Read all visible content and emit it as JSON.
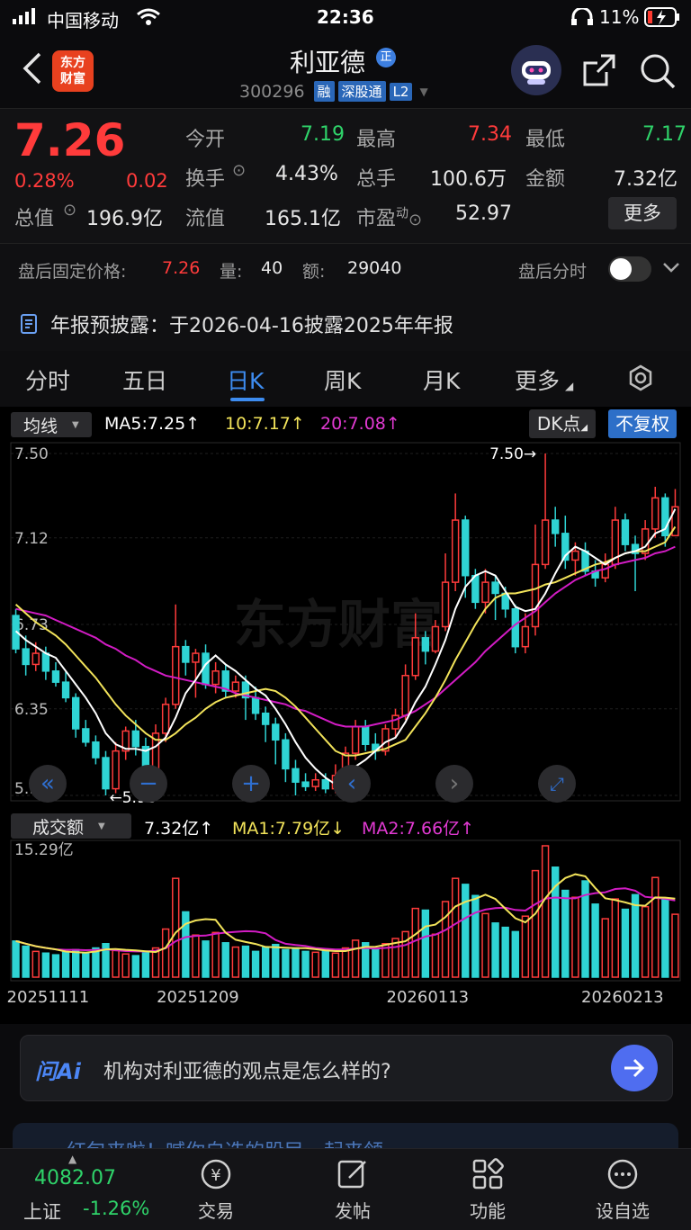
{
  "status_bar": {
    "carrier": "中国移动",
    "time": "22:36",
    "battery": "11%"
  },
  "header": {
    "logo_line1": "东方",
    "logo_line2": "财富",
    "stock_name": "利亚德",
    "badge": "正",
    "code": "300296",
    "tags": [
      "融",
      "深股通",
      "L2"
    ]
  },
  "quote": {
    "price": "7.26",
    "change_pct": "0.28%",
    "change": "0.02",
    "open_label": "今开",
    "open": "7.19",
    "high_label": "最高",
    "high": "7.34",
    "low_label": "最低",
    "low": "7.17",
    "turnover_label": "换手",
    "turnover": "4.43%",
    "volume_label": "总手",
    "volume": "100.6万",
    "amount_label": "金额",
    "amount": "7.32亿",
    "mcap_label": "总值",
    "mcap": "196.9亿",
    "float_label": "流值",
    "float": "165.1亿",
    "pe_label": "市盈",
    "pe_sup": "动",
    "pe": "52.97",
    "more_label": "更多"
  },
  "after_hours": {
    "price_label": "盘后固定价格:",
    "price": "7.26",
    "vol_label": "量:",
    "vol": "40",
    "amt_label": "额:",
    "amt": "29040",
    "switch_label": "盘后分时"
  },
  "notice": {
    "text": "年报预披露：于2026-04-16披露2025年年报"
  },
  "tabs": [
    {
      "label": "分时"
    },
    {
      "label": "五日"
    },
    {
      "label": "日K"
    },
    {
      "label": "周K"
    },
    {
      "label": "月K"
    },
    {
      "label": "更多"
    }
  ],
  "ma_bar": {
    "selector": "均线",
    "ma5": "MA5:7.25",
    "ma10": "10:7.17",
    "ma20": "20:7.08",
    "dk": "DK点",
    "adjust": "不复权"
  },
  "vol_bar": {
    "selector": "成交额",
    "value": "7.32亿",
    "ma1": "MA1:7.79亿",
    "ma2": "MA2:7.66亿",
    "max": "15.29亿"
  },
  "colors": {
    "up": "#ff3b3b",
    "down": "#2fd4d4",
    "ma5": "#ffffff",
    "ma10": "#f2e35a",
    "ma20": "#d21cc4",
    "accent": "#3d8cf0"
  },
  "chart_data": {
    "type": "candlestick",
    "y_ticks": [
      "7.50",
      "7.12",
      "6.73",
      "6.35",
      "5.96"
    ],
    "ylim": [
      5.96,
      7.5
    ],
    "high_marker": "7.50",
    "low_marker": "5.96",
    "dates": [
      "20251111",
      "20251209",
      "20260113",
      "20260213"
    ],
    "candles": [
      [
        6.77,
        6.62,
        6.8,
        6.6
      ],
      [
        6.62,
        6.55,
        6.68,
        6.5
      ],
      [
        6.55,
        6.6,
        6.65,
        6.52
      ],
      [
        6.6,
        6.52,
        6.63,
        6.48
      ],
      [
        6.52,
        6.47,
        6.56,
        6.45
      ],
      [
        6.47,
        6.4,
        6.52,
        6.38
      ],
      [
        6.4,
        6.26,
        6.42,
        6.22
      ],
      [
        6.26,
        6.2,
        6.3,
        6.18
      ],
      [
        6.2,
        6.13,
        6.23,
        6.1
      ],
      [
        6.13,
        5.99,
        6.16,
        5.96
      ],
      [
        5.99,
        6.16,
        6.2,
        5.97
      ],
      [
        6.16,
        6.25,
        6.27,
        6.12
      ],
      [
        6.25,
        6.18,
        6.3,
        6.14
      ],
      [
        6.18,
        6.08,
        6.22,
        6.05
      ],
      [
        6.08,
        6.24,
        6.28,
        6.06
      ],
      [
        6.24,
        6.37,
        6.4,
        6.2
      ],
      [
        6.37,
        6.63,
        6.82,
        6.35
      ],
      [
        6.63,
        6.56,
        6.66,
        6.5
      ],
      [
        6.56,
        6.6,
        6.62,
        6.4
      ],
      [
        6.6,
        6.46,
        6.64,
        6.44
      ],
      [
        6.46,
        6.52,
        6.56,
        6.42
      ],
      [
        6.52,
        6.43,
        6.55,
        6.4
      ],
      [
        6.43,
        6.47,
        6.5,
        6.4
      ],
      [
        6.47,
        6.4,
        6.5,
        6.3
      ],
      [
        6.4,
        6.33,
        6.45,
        6.3
      ],
      [
        6.33,
        6.28,
        6.36,
        6.2
      ],
      [
        6.28,
        6.21,
        6.31,
        6.1
      ],
      [
        6.21,
        6.08,
        6.24,
        6.02
      ],
      [
        6.08,
        6.02,
        6.12,
        5.96
      ],
      [
        6.02,
        6.0,
        6.06,
        5.98
      ],
      [
        6.0,
        6.03,
        6.06,
        5.98
      ],
      [
        6.03,
        5.99,
        6.06,
        5.97
      ],
      [
        5.99,
        6.05,
        6.1,
        5.97
      ],
      [
        6.05,
        6.15,
        6.18,
        6.02
      ],
      [
        6.15,
        6.27,
        6.3,
        6.12
      ],
      [
        6.27,
        6.19,
        6.3,
        6.16
      ],
      [
        6.19,
        6.16,
        6.24,
        6.12
      ],
      [
        6.16,
        6.26,
        6.28,
        6.14
      ],
      [
        6.26,
        6.32,
        6.35,
        6.22
      ],
      [
        6.32,
        6.5,
        6.55,
        6.3
      ],
      [
        6.5,
        6.67,
        6.78,
        6.48
      ],
      [
        6.67,
        6.61,
        6.7,
        6.55
      ],
      [
        6.61,
        6.72,
        6.75,
        6.6
      ],
      [
        6.72,
        6.92,
        7.05,
        6.7
      ],
      [
        6.92,
        7.2,
        7.32,
        6.88
      ],
      [
        7.2,
        6.95,
        7.22,
        6.85
      ],
      [
        6.95,
        6.83,
        6.98,
        6.8
      ],
      [
        6.83,
        6.92,
        6.98,
        6.78
      ],
      [
        6.92,
        6.87,
        6.95,
        6.75
      ],
      [
        6.87,
        6.8,
        6.9,
        6.76
      ],
      [
        6.8,
        6.63,
        6.82,
        6.6
      ],
      [
        6.63,
        6.72,
        6.78,
        6.6
      ],
      [
        6.72,
        7.0,
        7.18,
        6.68
      ],
      [
        7.0,
        7.2,
        7.5,
        6.98
      ],
      [
        7.2,
        7.14,
        7.26,
        7.08
      ],
      [
        7.14,
        7.02,
        7.22,
        6.98
      ],
      [
        7.02,
        7.06,
        7.1,
        6.95
      ],
      [
        7.06,
        6.97,
        7.1,
        6.95
      ],
      [
        6.97,
        6.94,
        7.02,
        6.9
      ],
      [
        6.94,
        7.0,
        7.05,
        6.92
      ],
      [
        7.0,
        7.2,
        7.26,
        6.98
      ],
      [
        7.2,
        7.09,
        7.23,
        7.06
      ],
      [
        7.09,
        7.05,
        7.13,
        6.88
      ],
      [
        7.05,
        7.16,
        7.2,
        7.02
      ],
      [
        7.16,
        7.3,
        7.35,
        7.12
      ],
      [
        7.3,
        7.13,
        7.32,
        7.08
      ],
      [
        7.13,
        7.26,
        7.34,
        7.17
      ]
    ],
    "amounts": [
      4.2,
      3.6,
      3.0,
      2.8,
      2.6,
      2.9,
      3.2,
      2.8,
      3.4,
      3.9,
      3.1,
      2.7,
      2.5,
      2.9,
      3.4,
      5.6,
      11.5,
      7.6,
      4.9,
      4.2,
      5.2,
      4.0,
      3.5,
      3.6,
      3.0,
      3.5,
      3.8,
      3.2,
      3.4,
      3.0,
      2.9,
      3.1,
      2.8,
      3.4,
      4.3,
      4.0,
      3.2,
      3.9,
      4.5,
      5.3,
      8.0,
      7.8,
      5.0,
      8.8,
      11.5,
      10.8,
      9.5,
      7.4,
      6.3,
      5.8,
      5.3,
      7.1,
      12.4,
      15.29,
      12.8,
      10.1,
      9.3,
      11.2,
      8.5,
      6.8,
      9.1,
      7.9,
      9.6,
      8.2,
      11.6,
      9.0,
      7.32
    ],
    "ma5": [
      6.7,
      6.66,
      6.63,
      6.6,
      6.58,
      6.52,
      6.46,
      6.4,
      6.33,
      6.24,
      6.19,
      6.17,
      6.17,
      6.16,
      6.18,
      6.22,
      6.31,
      6.42,
      6.48,
      6.55,
      6.59,
      6.55,
      6.52,
      6.48,
      6.44,
      6.41,
      6.35,
      6.28,
      6.2,
      6.13,
      6.08,
      6.04,
      6.01,
      6.03,
      6.09,
      6.12,
      6.16,
      6.2,
      6.22,
      6.29,
      6.38,
      6.45,
      6.55,
      6.66,
      6.8,
      6.9,
      6.95,
      6.97,
      6.95,
      6.88,
      6.81,
      6.79,
      6.8,
      6.87,
      6.96,
      7.04,
      7.08,
      7.06,
      7.03,
      7.0,
      7.03,
      7.05,
      7.06,
      7.08,
      7.14,
      7.16,
      7.25
    ],
    "ma10": [
      6.82,
      6.78,
      6.74,
      6.71,
      6.68,
      6.64,
      6.59,
      6.54,
      6.49,
      6.43,
      6.37,
      6.32,
      6.28,
      6.24,
      6.21,
      6.21,
      6.24,
      6.28,
      6.31,
      6.35,
      6.38,
      6.4,
      6.41,
      6.42,
      6.43,
      6.44,
      6.43,
      6.4,
      6.36,
      6.31,
      6.26,
      6.21,
      6.16,
      6.14,
      6.14,
      6.15,
      6.16,
      6.17,
      6.19,
      6.21,
      6.27,
      6.33,
      6.4,
      6.48,
      6.57,
      6.65,
      6.73,
      6.8,
      6.85,
      6.87,
      6.87,
      6.88,
      6.89,
      6.91,
      6.92,
      6.94,
      6.96,
      6.98,
      7.0,
      7.01,
      7.03,
      7.05,
      7.06,
      7.06,
      7.08,
      7.1,
      7.17
    ],
    "ma20": [
      6.8,
      6.79,
      6.78,
      6.77,
      6.75,
      6.73,
      6.71,
      6.69,
      6.67,
      6.64,
      6.62,
      6.59,
      6.57,
      6.54,
      6.52,
      6.5,
      6.49,
      6.48,
      6.47,
      6.46,
      6.45,
      6.44,
      6.42,
      6.41,
      6.4,
      6.39,
      6.38,
      6.37,
      6.35,
      6.34,
      6.32,
      6.3,
      6.28,
      6.27,
      6.27,
      6.27,
      6.28,
      6.29,
      6.3,
      6.32,
      6.34,
      6.37,
      6.4,
      6.44,
      6.48,
      6.52,
      6.56,
      6.61,
      6.65,
      6.69,
      6.73,
      6.76,
      6.79,
      6.83,
      6.87,
      6.9,
      6.93,
      6.95,
      6.97,
      6.98,
      7.0,
      7.01,
      7.02,
      7.03,
      7.05,
      7.06,
      7.08
    ]
  },
  "ai": {
    "brand": "问Ai",
    "prompt": "机构对利亚德的观点是怎么样的?"
  },
  "banner": {
    "text": "红包来啦！喊你自选的股民一起来领~"
  },
  "bottom_nav": {
    "index_value": "4082.07",
    "index_name": "上证",
    "index_change": "-1.26%",
    "items": [
      "交易",
      "发帖",
      "功能",
      "设自选"
    ]
  }
}
